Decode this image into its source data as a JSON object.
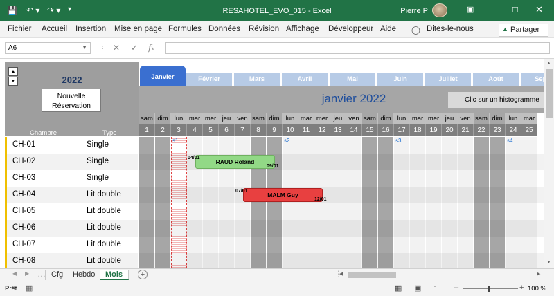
{
  "window": {
    "title": "RESAHOTEL_EVO_015  -  Excel",
    "user": "Pierre P"
  },
  "ribbon": {
    "tabs": [
      "Fichier",
      "Accueil",
      "Insertion",
      "Mise en page",
      "Formules",
      "Données",
      "Révision",
      "Affichage",
      "Développeur",
      "Aide"
    ],
    "tell_me": "Dites-le-nous",
    "share": "Partager"
  },
  "formula_bar": {
    "name_box": "A6",
    "formula": ""
  },
  "panel": {
    "year": "2022",
    "new_button_line1": "Nouvelle",
    "new_button_line2": "Réservation",
    "col_chambre": "Chambre",
    "col_type": "Type"
  },
  "months": [
    "Janvier",
    "Février",
    "Mars",
    "Avril",
    "Mai",
    "Juin",
    "Juillet",
    "Août",
    "Septe"
  ],
  "month_title": "janvier 2022",
  "clic_label": "Clic sur un histogramme",
  "days": [
    [
      "sam",
      "1"
    ],
    [
      "dim",
      "2"
    ],
    [
      "lun",
      "3"
    ],
    [
      "mar",
      "4"
    ],
    [
      "mer",
      "5"
    ],
    [
      "jeu",
      "6"
    ],
    [
      "ven",
      "7"
    ],
    [
      "sam",
      "8"
    ],
    [
      "dim",
      "9"
    ],
    [
      "lun",
      "10"
    ],
    [
      "mar",
      "11"
    ],
    [
      "mer",
      "12"
    ],
    [
      "jeu",
      "13"
    ],
    [
      "ven",
      "14"
    ],
    [
      "sam",
      "15"
    ],
    [
      "dim",
      "16"
    ],
    [
      "lun",
      "17"
    ],
    [
      "mar",
      "18"
    ],
    [
      "mer",
      "19"
    ],
    [
      "jeu",
      "20"
    ],
    [
      "ven",
      "21"
    ],
    [
      "sam",
      "22"
    ],
    [
      "dim",
      "23"
    ],
    [
      "lun",
      "24"
    ],
    [
      "mar",
      "25"
    ]
  ],
  "weeks": [
    "s1",
    "s2",
    "s3",
    "s4"
  ],
  "rooms": [
    {
      "id": "CH-01",
      "type": "Single"
    },
    {
      "id": "CH-02",
      "type": "Single"
    },
    {
      "id": "CH-03",
      "type": "Single"
    },
    {
      "id": "CH-04",
      "type": "Lit double"
    },
    {
      "id": "CH-05",
      "type": "Lit double"
    },
    {
      "id": "CH-06",
      "type": "Lit double"
    },
    {
      "id": "CH-07",
      "type": "Lit double"
    },
    {
      "id": "CH-08",
      "type": "Lit double"
    }
  ],
  "reservations": [
    {
      "name": "RAUD Roland",
      "start": "04/01",
      "end": "09/01",
      "color": "#92d986"
    },
    {
      "name": "MALM Guy",
      "start": "07/01",
      "end": "12/01",
      "color": "#e84040"
    }
  ],
  "sheet_tabs": [
    "Cfg",
    "Hebdo",
    "Mois"
  ],
  "status": {
    "ready": "Prêt",
    "zoom": "100 %"
  },
  "colors": {
    "excel_green": "#217346",
    "active_month": "#3a6fd0",
    "month_tab": "#b7cbe6"
  }
}
